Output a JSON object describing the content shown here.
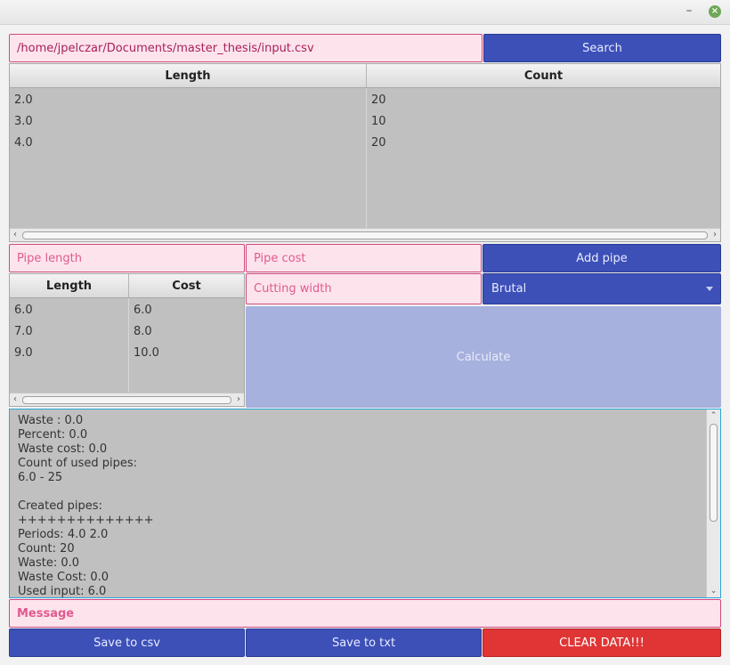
{
  "window": {
    "minimize_glyph": "–",
    "close_glyph": "×"
  },
  "file": {
    "path": "/home/jpelczar/Documents/master_thesis/input.csv",
    "search_label": "Search"
  },
  "input_table": {
    "columns": [
      "Length",
      "Count"
    ],
    "rows": [
      [
        "2.0",
        "20"
      ],
      [
        "3.0",
        "10"
      ],
      [
        "4.0",
        "20"
      ]
    ]
  },
  "pipe_form": {
    "length_placeholder": "Pipe length",
    "cost_placeholder": "Pipe cost",
    "add_label": "Add pipe",
    "cutting_width_placeholder": "Cutting width",
    "algorithm_selected": "Brutal",
    "calculate_label": "Calculate"
  },
  "pipe_table": {
    "columns": [
      "Length",
      "Cost"
    ],
    "rows": [
      [
        "6.0",
        "6.0"
      ],
      [
        "7.0",
        "8.0"
      ],
      [
        "9.0",
        "10.0"
      ]
    ]
  },
  "output_lines": [
    "Waste : 0.0",
    "Percent: 0.0",
    "Waste cost: 0.0",
    "Count of used pipes:",
    "6.0 - 25",
    "",
    "Created pipes:",
    "++++++++++++++",
    "Periods: 4.0 2.0",
    "Count: 20",
    "Waste: 0.0",
    "Waste Cost: 0.0",
    "Used input: 6.0"
  ],
  "message_label": "Message",
  "actions": {
    "save_csv": "Save to csv",
    "save_txt": "Save to txt",
    "clear": "CLEAR DATA!!!"
  },
  "colors": {
    "primary": "#3d50b8",
    "danger": "#e03535",
    "field_bg": "#fde4ec",
    "field_border": "#d0497e"
  }
}
